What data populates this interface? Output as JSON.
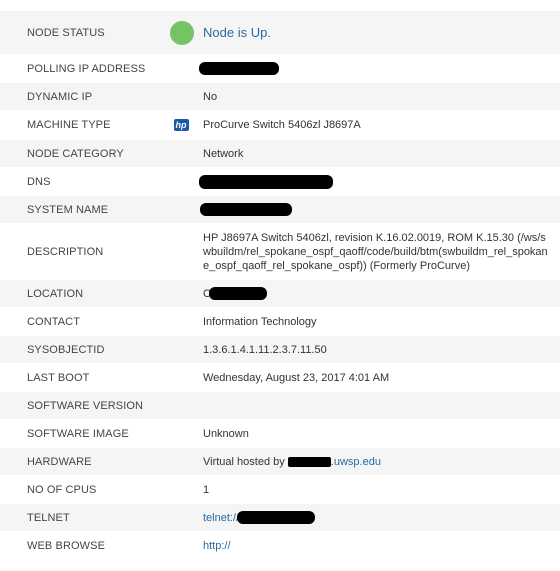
{
  "rows": [
    {
      "label": "NODE STATUS",
      "value": "Node is Up."
    },
    {
      "label": "POLLING IP ADDRESS",
      "value": ""
    },
    {
      "label": "DYNAMIC IP",
      "value": "No"
    },
    {
      "label": "MACHINE TYPE",
      "value": "ProCurve Switch 5406zl J8697A"
    },
    {
      "label": "NODE CATEGORY",
      "value": "Network"
    },
    {
      "label": "DNS",
      "value": ""
    },
    {
      "label": "SYSTEM NAME",
      "value": ""
    },
    {
      "label": "DESCRIPTION",
      "value": "HP J8697A Switch 5406zl, revision K.16.02.0019, ROM K.15.30 (/ws/swbuildm/rel_spokane_ospf_qaoff/code/build/btm(swbuildm_rel_spokane_ospf_qaoff_rel_spokane_ospf)) (Formerly ProCurve)"
    },
    {
      "label": "LOCATION",
      "value": "C"
    },
    {
      "label": "CONTACT",
      "value": "Information Technology"
    },
    {
      "label": "SYSOBJECTID",
      "value": "1.3.6.1.4.1.11.2.3.7.11.50"
    },
    {
      "label": "LAST BOOT",
      "value": "Wednesday, August 23, 2017 4:01 AM"
    },
    {
      "label": "SOFTWARE VERSION",
      "value": ""
    },
    {
      "label": "SOFTWARE IMAGE",
      "value": "Unknown"
    },
    {
      "label": "HARDWARE",
      "value_prefix": "Virtual hosted by ",
      "value_link": ".uwsp.edu"
    },
    {
      "label": "NO OF CPUS",
      "value": "1"
    },
    {
      "label": "TELNET",
      "value": "telnet://"
    },
    {
      "label": "WEB BROWSE",
      "value": "http://"
    }
  ],
  "icons": {
    "status": "status-up-icon",
    "machine": "hp-logo-icon",
    "status_color": "#76c364"
  },
  "colors": {
    "link": "#2a6aa3",
    "row_alt": "#f5f5f5"
  }
}
